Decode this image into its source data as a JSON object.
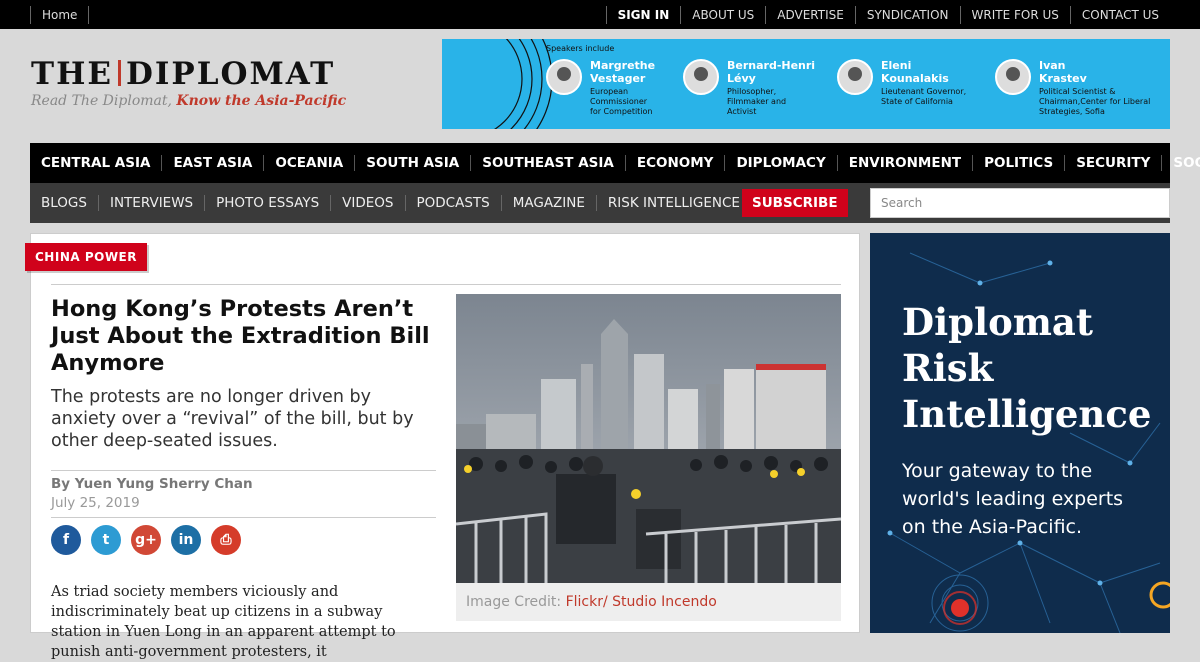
{
  "topbar": {
    "home": "Home",
    "links": [
      "SIGN IN",
      "ABOUT US",
      "ADVERTISE",
      "SYNDICATION",
      "WRITE FOR US",
      "CONTACT US"
    ]
  },
  "logo": {
    "left": "THE",
    "right": "DIPLOMAT",
    "tagline_a": "Read The Diplomat,",
    "tagline_b": "Know the Asia-Pacific"
  },
  "banner_ad": {
    "speakers_label": "Speakers include",
    "speakers": [
      {
        "name": "Margrethe Vestager",
        "role": "European Commissioner for Competition"
      },
      {
        "name": "Bernard-Henri Lévy",
        "role": "Philosopher, Filmmaker and Activist"
      },
      {
        "name": "Eleni Kounalakis",
        "role": "Lieutenant Governor, State of California"
      },
      {
        "name": "Ivan Krastev",
        "role": "Political Scientist & Chairman,Center for Liberal Strategies, Sofia"
      }
    ]
  },
  "main_nav": [
    "CENTRAL ASIA",
    "EAST ASIA",
    "OCEANIA",
    "SOUTH ASIA",
    "SOUTHEAST ASIA",
    "ECONOMY",
    "DIPLOMACY",
    "ENVIRONMENT",
    "POLITICS",
    "SECURITY",
    "SOCIETY"
  ],
  "sub_nav": [
    "BLOGS",
    "INTERVIEWS",
    "PHOTO ESSAYS",
    "VIDEOS",
    "PODCASTS",
    "MAGAZINE",
    "RISK INTELLIGENCE"
  ],
  "subscribe_label": "SUBSCRIBE",
  "search": {
    "placeholder": "Search"
  },
  "article": {
    "category": "CHINA POWER",
    "headline": "Hong Kong’s Protests Aren’t Just About the Extradition Bill Anymore",
    "dek": "The protests are no longer driven by anxiety over a “revival” of the bill, but by other deep-seated issues.",
    "byline": "By Yuen Yung Sherry Chan",
    "date": "July 25, 2019",
    "body": "As triad society members viciously and indiscriminately beat up citizens in a subway station in Yuen Long in an apparent attempt to punish anti-government protesters, it",
    "credit_label": "Image Credit: ",
    "credit_source": "Flickr/ Studio Incendo",
    "share_icons": [
      {
        "icon": "facebook-icon",
        "glyph": "f",
        "color": "#1f5a9c"
      },
      {
        "icon": "twitter-icon",
        "glyph": "t",
        "color": "#2d9bd3"
      },
      {
        "icon": "googleplus-icon",
        "glyph": "g+",
        "color": "#d14836"
      },
      {
        "icon": "linkedin-icon",
        "glyph": "in",
        "color": "#1d6fa5"
      },
      {
        "icon": "print-icon",
        "glyph": "⎙",
        "color": "#d53c2a"
      }
    ]
  },
  "side_ad": {
    "title": "Diplomat Risk Intelligence",
    "subtitle": "Your gateway to the world's leading experts on the Asia-Pacific."
  }
}
